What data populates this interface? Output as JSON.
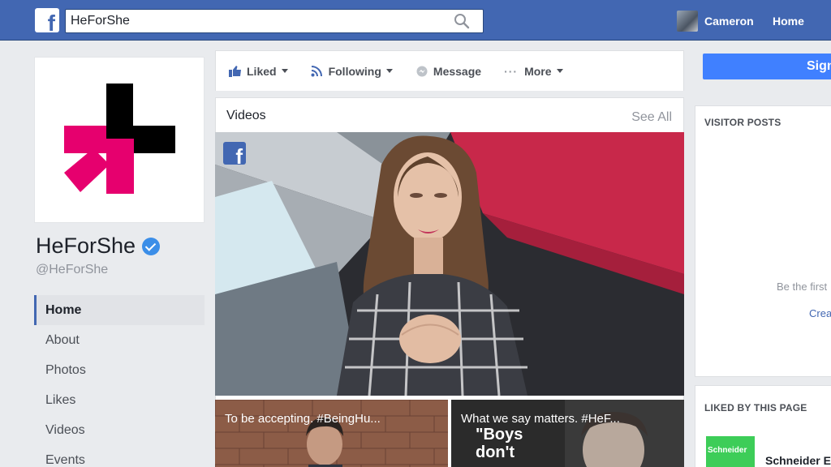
{
  "topbar": {
    "search_value": "HeForShe",
    "user_name": "Cameron",
    "home_label": "Home"
  },
  "page": {
    "name": "HeForShe",
    "handle": "@HeForShe"
  },
  "nav": {
    "items": [
      {
        "label": "Home",
        "active": true
      },
      {
        "label": "About"
      },
      {
        "label": "Photos"
      },
      {
        "label": "Likes"
      },
      {
        "label": "Videos"
      },
      {
        "label": "Events"
      }
    ]
  },
  "actions": {
    "liked": "Liked",
    "following": "Following",
    "message": "Message",
    "more": "More"
  },
  "videos": {
    "title": "Videos",
    "see_all": "See All",
    "thumbs": [
      {
        "title": "To be accepting. #BeingHu..."
      },
      {
        "title": "What we say matters. #HeF...",
        "quote": "\"Boys\ndon't"
      }
    ]
  },
  "right": {
    "signup_label": "Sign",
    "visitor_posts_title": "VISITOR POSTS",
    "be_first": "Be the first",
    "create_link": "Crea",
    "liked_by_title": "LIKED BY THIS PAGE",
    "liked_logo_text": "Schneider",
    "liked_name": "Schneider E"
  },
  "colors": {
    "brand_blue": "#4267b2",
    "heforshe_pink": "#e6006e",
    "button_blue": "#4080ff"
  }
}
